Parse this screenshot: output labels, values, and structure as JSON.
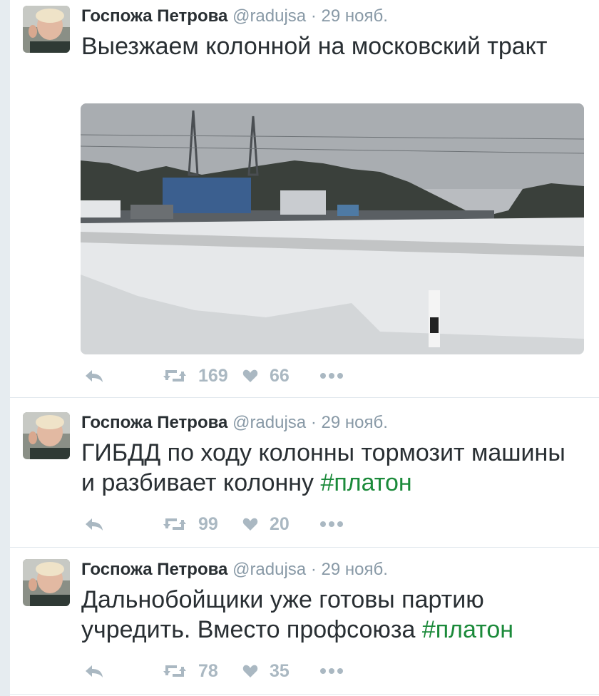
{
  "tweets": [
    {
      "author": "Госпожа Петрова",
      "handle": "@radujsa",
      "separator": "·",
      "date": "29 нояб.",
      "text": "Выезжаем колонной на московский тракт",
      "hashtag": "",
      "retweets": "169",
      "likes": "66"
    },
    {
      "author": "Госпожа Петрова",
      "handle": "@radujsa",
      "separator": "·",
      "date": "29 нояб.",
      "text": "ГИБДД по ходу колонны тормозит машины и разбивает колонну ",
      "hashtag": "#платон",
      "retweets": "99",
      "likes": "20"
    },
    {
      "author": "Госпожа Петрова",
      "handle": "@radujsa",
      "separator": "·",
      "date": "29 нояб.",
      "text": "Дальнобойщики уже готовы партию учредить. Вместо профсоюза ",
      "hashtag": "#платон",
      "retweets": "78",
      "likes": "35"
    }
  ],
  "icons": {
    "reply": "reply-icon",
    "retweet": "retweet-icon",
    "like": "heart-icon",
    "more": "more-icon"
  },
  "colors": {
    "hashtag": "#1b8a3a",
    "meta": "#8899a6",
    "action": "#aab8c2"
  }
}
